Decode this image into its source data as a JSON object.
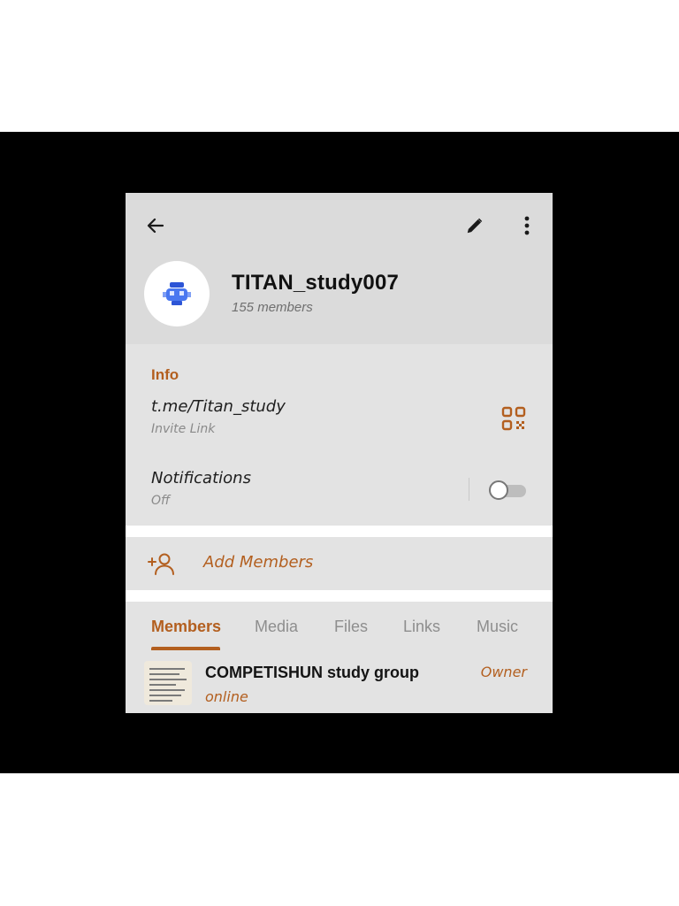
{
  "header": {
    "group_name": "TITAN_study007",
    "member_count": "155 members",
    "icons": [
      "back-arrow-icon",
      "pencil-icon",
      "more-vertical-icon"
    ]
  },
  "info": {
    "section_title": "Info",
    "invite_link": "t.me/Titan_study",
    "invite_link_label": "Invite Link",
    "notifications_label": "Notifications",
    "notifications_value": "Off",
    "notifications_enabled": false
  },
  "add_members": {
    "label": "Add Members"
  },
  "tabs": [
    {
      "label": "Members",
      "active": true
    },
    {
      "label": "Media",
      "active": false
    },
    {
      "label": "Files",
      "active": false
    },
    {
      "label": "Links",
      "active": false
    },
    {
      "label": "Music",
      "active": false
    }
  ],
  "members": [
    {
      "name": "COMPETISHUN study group",
      "status": "online",
      "role": "Owner"
    }
  ],
  "colors": {
    "accent": "#b35f1f",
    "header_bg": "#dbdbdb",
    "body_bg": "#e3e3e3"
  }
}
